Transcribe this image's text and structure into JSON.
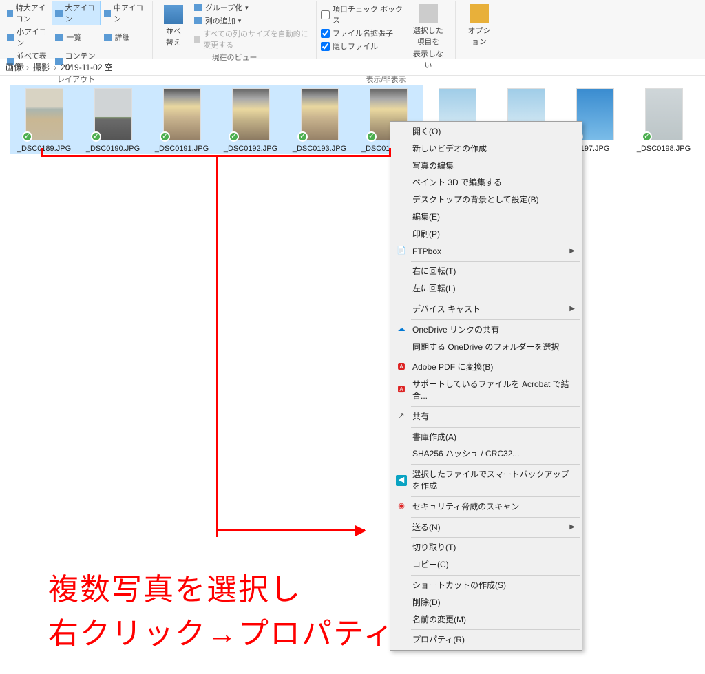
{
  "ribbon": {
    "layout": {
      "xl_icon": "特大アイコン",
      "l_icon": "大アイコン",
      "m_icon": "中アイコン",
      "s_icon": "小アイコン",
      "list": "一覧",
      "details": "詳細",
      "tiles": "並べて表示",
      "content": "コンテンツ",
      "group_label": "レイアウト"
    },
    "view": {
      "sort": "並べ替え",
      "group_by": "グループ化",
      "add_column": "列の追加",
      "auto_size": "すべての列のサイズを自動的に変更する",
      "group_label": "現在のビュー"
    },
    "show": {
      "checkboxes": "項目チェック ボックス",
      "extensions": "ファイル名拡張子",
      "hidden": "隠しファイル",
      "hide_selected_line1": "選択した項目を",
      "hide_selected_line2": "表示しない",
      "options": "オプション",
      "group_label": "表示/非表示"
    }
  },
  "breadcrumb": {
    "a": "画像",
    "b": "撮影",
    "c": "2019-11-02 空"
  },
  "files": [
    {
      "name": "_DSC0189.JPG",
      "selected": true,
      "cls": "thumb"
    },
    {
      "name": "_DSC0190.JPG",
      "selected": true,
      "cls": "thumb road"
    },
    {
      "name": "_DSC0191.JPG",
      "selected": true,
      "cls": "thumb sunset"
    },
    {
      "name": "_DSC0192.JPG",
      "selected": true,
      "cls": "thumb sunset2"
    },
    {
      "name": "_DSC0193.JPG",
      "selected": true,
      "cls": "thumb sunset"
    },
    {
      "name": "_DSC0194.JPG",
      "selected": true,
      "cls": "thumb sunset2"
    },
    {
      "name": "",
      "selected": false,
      "cls": "thumb sky2"
    },
    {
      "name": "",
      "selected": false,
      "cls": "thumb sky2"
    },
    {
      "name": "197.JPG",
      "selected": false,
      "cls": "thumb sky3"
    },
    {
      "name": "_DSC0198.JPG",
      "selected": false,
      "cls": "thumb skyg"
    }
  ],
  "menu": {
    "open": "開く(O)",
    "new_video": "新しいビデオの作成",
    "edit_photo": "写真の編集",
    "paint3d": "ペイント 3D で編集する",
    "wallpaper": "デスクトップの背景として設定(B)",
    "edit": "編集(E)",
    "print": "印刷(P)",
    "ftpbox": "FTPbox",
    "rotate_r": "右に回転(T)",
    "rotate_l": "左に回転(L)",
    "cast": "デバイス キャスト",
    "od_share": "OneDrive リンクの共有",
    "od_folder": "同期する OneDrive のフォルダーを選択",
    "pdf": "Adobe PDF に変換(B)",
    "acrobat": "サポートしているファイルを Acrobat で結合...",
    "share": "共有",
    "archive": "書庫作成(A)",
    "sha256": "SHA256 ハッシュ / CRC32...",
    "backup": "選択したファイルでスマートバックアップを作成",
    "security": "セキュリティ脅威のスキャン",
    "sendto": "送る(N)",
    "cut": "切り取り(T)",
    "copy": "コピー(C)",
    "shortcut": "ショートカットの作成(S)",
    "delete": "削除(D)",
    "rename": "名前の変更(M)",
    "properties": "プロパティ(R)"
  },
  "annotation": {
    "line1": "複数写真を選択し",
    "line2": "右クリック→プロパティ"
  }
}
